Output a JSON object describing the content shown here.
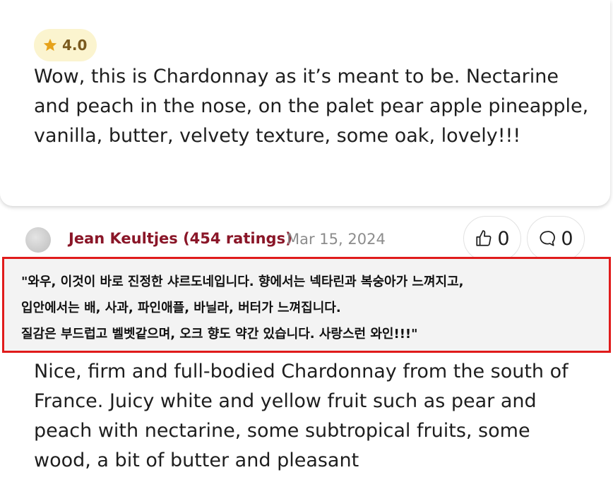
{
  "review1": {
    "rating": "4.0",
    "text": "Wow, this is Chardonnay as it’s meant to be. Nectarine and peach in the nose, on the palet pear apple pineapple, vanilla, butter, velvety texture, some oak, lovely!!!"
  },
  "review2": {
    "author": "Jean Keultjes (454 ratings)",
    "date": "Mar 15, 2024",
    "likes": "0",
    "comments": "0",
    "text": "Nice, firm and full-bodied Chardonnay from the south of France. Juicy white and yellow fruit such as pear and peach with nectarine, some subtropical fruits, some wood, a bit of butter and pleasant"
  },
  "translation": {
    "lines": [
      "\"와우, 이것이 바로 진정한 샤르도네입니다. 향에서는 넥타린과 복숭아가 느껴지고,",
      "입안에서는 배, 사과, 파인애플, 바닐라, 버터가 느껴집니다.",
      "질감은 부드럽고 벨벳같으며, 오크 향도 약간 있습니다. 사랑스런 와인!!!\""
    ]
  },
  "colors": {
    "author": "#8a1628",
    "badge_bg": "#fbf4cf",
    "star": "#e6a21a",
    "highlight_border": "#e01b1b"
  }
}
